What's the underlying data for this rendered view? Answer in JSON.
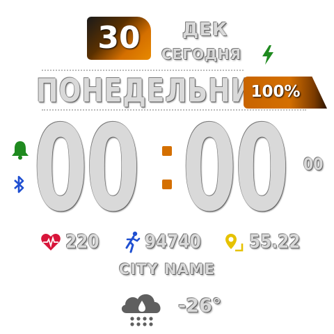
{
  "date": {
    "day": "30",
    "month": "ДЕК",
    "today_label": "СЕГОДНЯ",
    "weekday": "ПОНЕДЕЛЬНИК"
  },
  "battery": {
    "percent_text": "100%"
  },
  "time": {
    "hours": "00",
    "minutes": "00",
    "seconds": "00"
  },
  "stats": {
    "heart_rate": "220",
    "steps": "94740",
    "distance": "55.22"
  },
  "weather": {
    "city": "CITY NAME",
    "temperature": "-26°",
    "condition_icon": "rain-cloud-icon"
  },
  "icons": [
    "bolt-icon",
    "bell-icon",
    "bluetooth-icon",
    "heart-rate-icon",
    "running-icon",
    "location-icon",
    "rain-cloud-icon"
  ],
  "colors": {
    "accent_orange": "#d46f00",
    "green": "#1f8a1f",
    "blue": "#1f4fd1",
    "red": "#d8153a",
    "yellow": "#e6c200"
  }
}
